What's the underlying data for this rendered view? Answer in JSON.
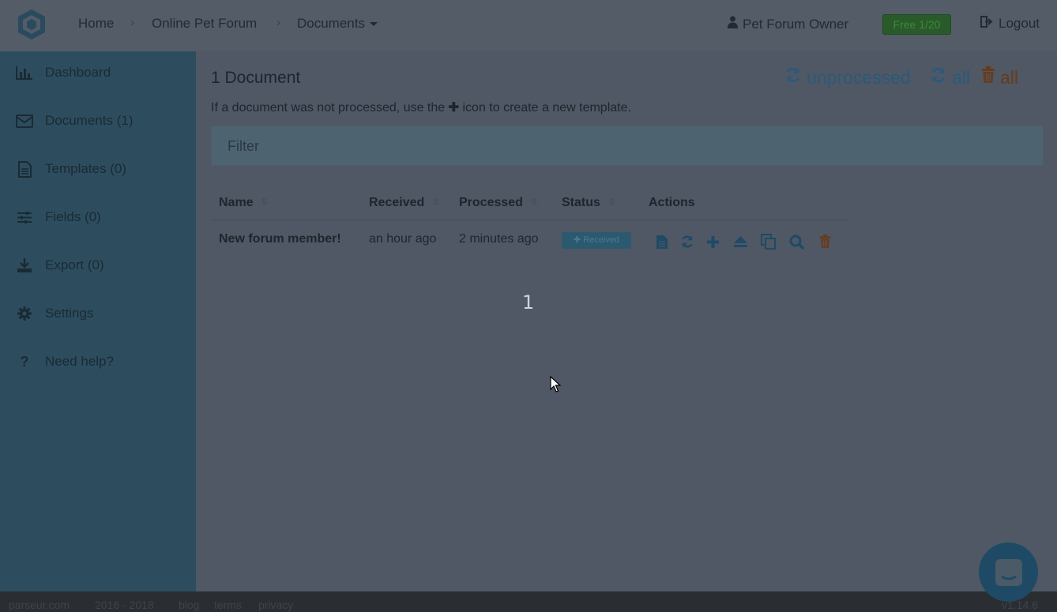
{
  "topbar": {
    "breadcrumbs": [
      "Home",
      "Online Pet Forum",
      "Documents"
    ],
    "user_name": "Pet Forum Owner",
    "plan_badge": "Free 1/20",
    "logout_label": "Logout"
  },
  "sidebar": {
    "items": [
      {
        "label": "Dashboard",
        "icon": "bar-chart-icon"
      },
      {
        "label": "Documents (1)",
        "icon": "envelope-icon"
      },
      {
        "label": "Templates (0)",
        "icon": "document-icon"
      },
      {
        "label": "Fields (0)",
        "icon": "sliders-icon"
      },
      {
        "label": "Export (0)",
        "icon": "download-icon"
      },
      {
        "label": "Settings",
        "icon": "gear-icon"
      },
      {
        "label": "Need help?",
        "icon": "question-icon"
      }
    ]
  },
  "main": {
    "title": "1 Document",
    "hint_before": "If a document was not processed, use the",
    "hint_after": "icon to create a new template.",
    "reprocess_unprocessed_label": "unprocessed",
    "reprocess_all_label": "all",
    "delete_all_label": "all",
    "filter_label": "Filter",
    "table": {
      "columns": [
        "Name",
        "Received",
        "Processed",
        "Status",
        "Actions"
      ],
      "rows": [
        {
          "name": "New forum member!",
          "received": "an hour ago",
          "processed": "2 minutes ago",
          "status": "Received"
        }
      ]
    },
    "page_number": "1"
  },
  "footer": {
    "site": "parseur.com",
    "years": "2016 - 2018",
    "links": [
      "blog",
      "terms",
      "privacy"
    ],
    "version": "v1.14.6"
  },
  "colors": {
    "sidebar": "#2d4d5e",
    "accent": "#2a5a7a",
    "danger": "#6a3a1a",
    "badge_green": "#2a5a2a"
  }
}
